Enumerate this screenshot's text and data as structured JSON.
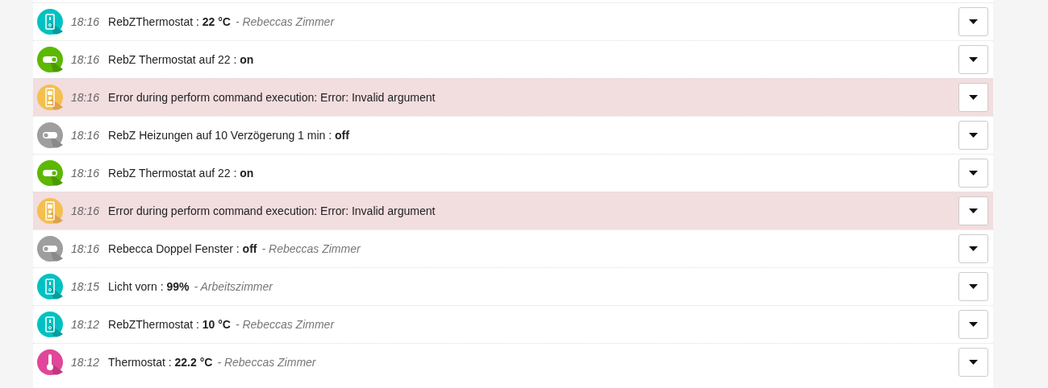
{
  "events": [
    {
      "kind": "dimmer",
      "time": "18:16",
      "text": "RebZThermostat : ",
      "value": "22 °C",
      "room": "- Rebeccas Zimmer",
      "error": false
    },
    {
      "kind": "switch",
      "on": true,
      "time": "18:16",
      "text": "RebZ Thermostat auf 22 : ",
      "value": "on",
      "error": false
    },
    {
      "kind": "remote",
      "time": "18:16",
      "text": "Error during perform command execution: Error: Invalid argument",
      "error": true
    },
    {
      "kind": "switch",
      "on": false,
      "time": "18:16",
      "text": "RebZ Heizungen auf 10 Verzögerung 1 min : ",
      "value": "off",
      "error": false
    },
    {
      "kind": "switch",
      "on": true,
      "time": "18:16",
      "text": "RebZ Thermostat auf 22 : ",
      "value": "on",
      "error": false
    },
    {
      "kind": "remote",
      "time": "18:16",
      "text": "Error during perform command execution: Error: Invalid argument",
      "error": true
    },
    {
      "kind": "switch",
      "on": false,
      "time": "18:16",
      "text": "Rebecca Doppel Fenster : ",
      "value": "off",
      "room": "- Rebeccas Zimmer",
      "error": false
    },
    {
      "kind": "dimmer",
      "time": "18:15",
      "text": "Licht vorn : ",
      "value": "99%",
      "room": "- Arbeitszimmer",
      "error": false
    },
    {
      "kind": "dimmer",
      "time": "18:12",
      "text": "RebZThermostat : ",
      "value": "10 °C",
      "room": "- Rebeccas Zimmer",
      "error": false
    },
    {
      "kind": "thermometer",
      "time": "18:12",
      "text": "Thermostat : ",
      "value": "22.2 °C",
      "room": "- Rebeccas Zimmer",
      "error": false
    }
  ]
}
